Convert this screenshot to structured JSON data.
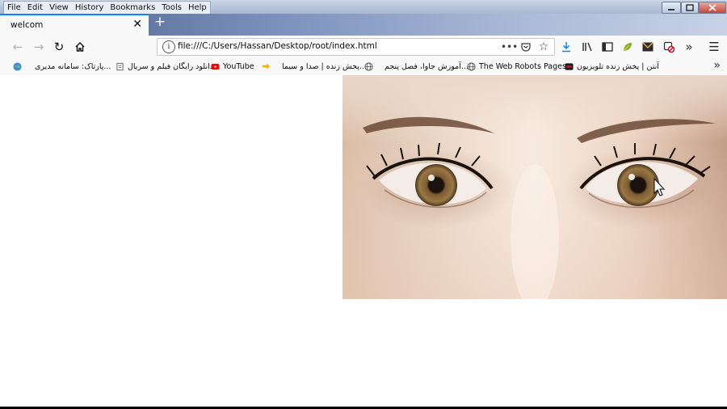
{
  "menu": [
    "File",
    "Edit",
    "View",
    "History",
    "Bookmarks",
    "Tools",
    "Help"
  ],
  "tab": {
    "title": "welcom",
    "close_icon": "close-icon"
  },
  "newtab_label": "+",
  "url": "file:///C:/Users/Hassan/Desktop/root/index.html",
  "bookmarks": [
    {
      "label": "پارتاک: سامانه مدیری...",
      "icon": "globe-color-icon",
      "color": "#3d8fd8"
    },
    {
      "label": "دانلود رایگان فیلم و سریال",
      "icon": "page-icon",
      "color": "#777777"
    },
    {
      "label": "YouTube",
      "icon": "youtube-icon",
      "color": "#ff0000"
    },
    {
      "label": "پخش زنده | صدا و سیما...",
      "icon": "arrow-icon",
      "color": "#f5b400"
    },
    {
      "label": "آموزش جاوا، فصل پنجم...",
      "icon": "globe-icon",
      "color": "#555555"
    },
    {
      "label": "The Web Robots Pages",
      "icon": "globe-icon",
      "color": "#555555"
    },
    {
      "label": "آنتن | پخش زنده تلویزیون",
      "icon": "antenna-icon",
      "color": "#c8102e"
    }
  ]
}
